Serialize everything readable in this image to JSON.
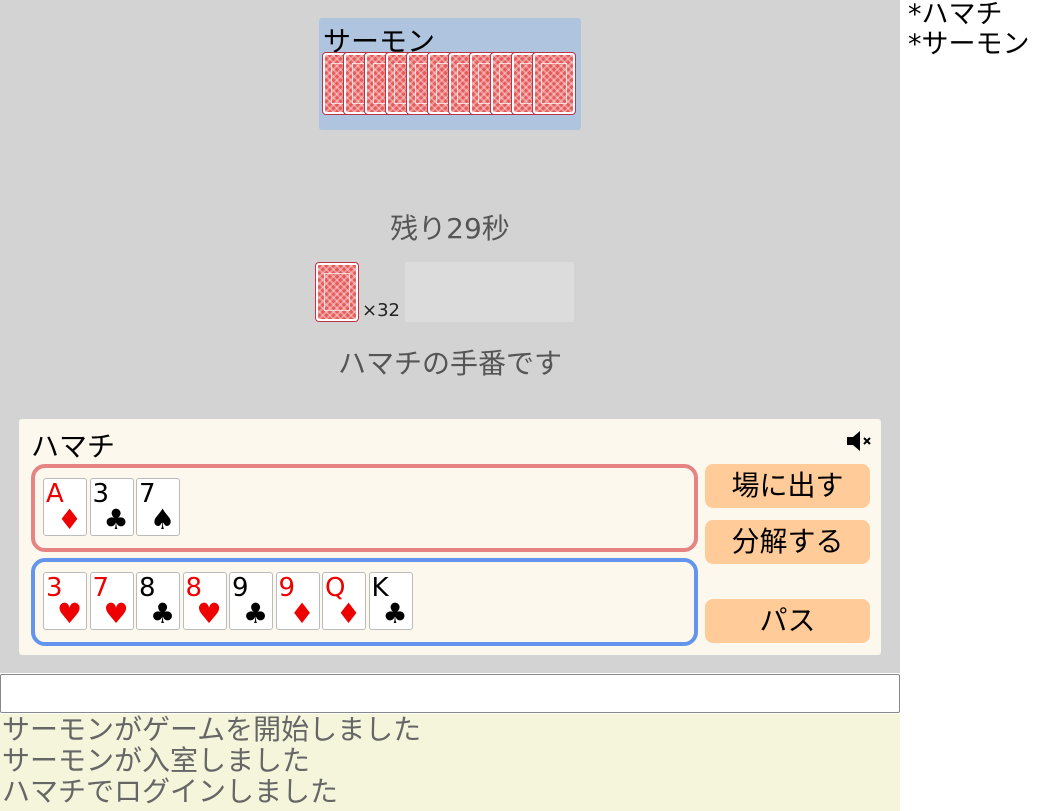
{
  "users": [
    "*ハマチ",
    "*サーモン"
  ],
  "opponent": {
    "name": "サーモン",
    "card_count": 11
  },
  "timer_text": "残り29秒",
  "deck": {
    "count_text": "×32"
  },
  "turn_text": "ハマチの手番です",
  "player": {
    "name": "ハマチ",
    "selected_cards": [
      {
        "rank": "A",
        "suit": "♦",
        "color": "red"
      },
      {
        "rank": "3",
        "suit": "♣",
        "color": "black"
      },
      {
        "rank": "7",
        "suit": "♠",
        "color": "black"
      }
    ],
    "hand_cards": [
      {
        "rank": "3",
        "suit": "♥",
        "color": "red"
      },
      {
        "rank": "7",
        "suit": "♥",
        "color": "red"
      },
      {
        "rank": "8",
        "suit": "♣",
        "color": "black"
      },
      {
        "rank": "8",
        "suit": "♥",
        "color": "red"
      },
      {
        "rank": "9",
        "suit": "♣",
        "color": "black"
      },
      {
        "rank": "9",
        "suit": "♦",
        "color": "red"
      },
      {
        "rank": "Q",
        "suit": "♦",
        "color": "red"
      },
      {
        "rank": "K",
        "suit": "♣",
        "color": "black"
      }
    ],
    "mute_icon": "speaker-muted-icon"
  },
  "buttons": {
    "play": "場に出す",
    "split": "分解する",
    "pass": "パス"
  },
  "chat": {
    "input_value": "",
    "placeholder": ""
  },
  "log": [
    "サーモンがゲームを開始しました",
    "サーモンが入室しました",
    "ハマチでログインしました"
  ]
}
